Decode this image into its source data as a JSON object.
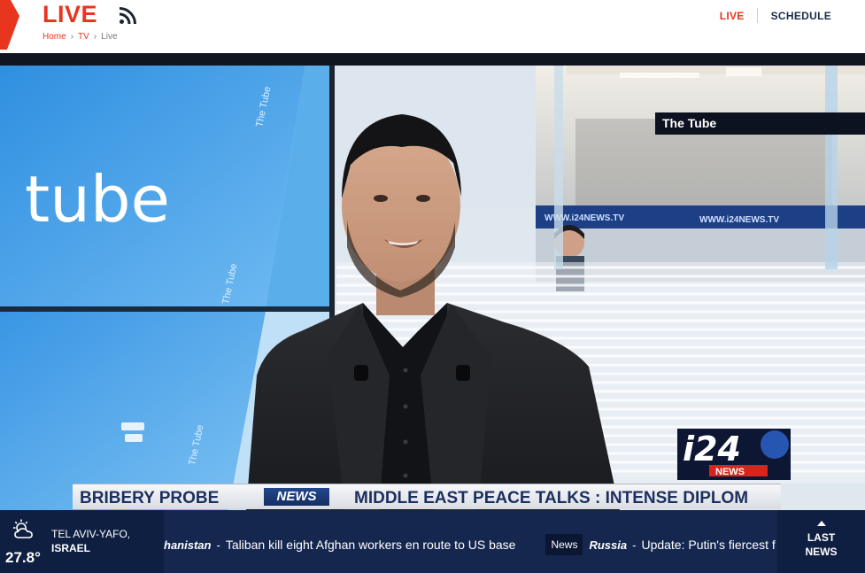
{
  "header": {
    "title": "LIVE",
    "breadcrumb": [
      "Home",
      "TV",
      "Live"
    ],
    "nav": {
      "live": "LIVE",
      "schedule": "SCHEDULE"
    }
  },
  "player": {
    "screen_text": "tube",
    "tag": "The Tube",
    "wall_text": "The Tube",
    "banner_text": "WWW.i24NEWS.TV",
    "logo_main": "i24",
    "logo_sub": "NEWS",
    "lower_third": {
      "story": "BRIBERY PROBE",
      "label": "NEWS",
      "headline": "MIDDLE EAST PEACE TALKS : INTENSE DIPLOM"
    }
  },
  "weather": {
    "icon": "partly-cloudy-icon",
    "temperature": "27.8°",
    "city": "TEL AVIV-YAFO,",
    "country": "ISRAEL"
  },
  "ticker": {
    "items": [
      {
        "category": "hanistan",
        "text": "Taliban kill eight Afghan workers en route to US base"
      },
      {
        "badge": "News",
        "category": "Russia",
        "text": "Update: Putin's fiercest f"
      }
    ]
  },
  "last_news": "LAST NEWS",
  "colors": {
    "accent": "#e8361e",
    "navy": "#15274f",
    "screen_blue": "#3f9de8"
  }
}
